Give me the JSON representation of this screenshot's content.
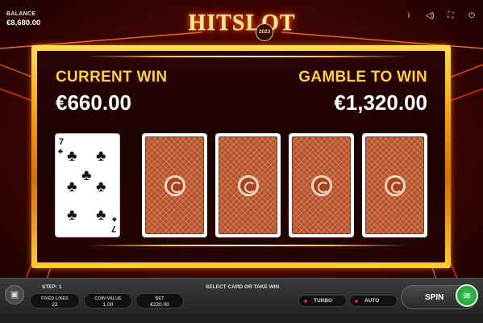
{
  "header": {
    "balance_label": "BALANCE",
    "balance_value": "€8,680.00",
    "logo_text": "HITSLOT",
    "logo_year": "2023",
    "icons": [
      "info-icon",
      "sound-icon",
      "fullscreen-icon",
      "power-icon"
    ],
    "icon_glyphs": {
      "info": "i",
      "sound": "◁)",
      "fullscreen": "⛶",
      "power": "⏻"
    }
  },
  "gamble": {
    "current_win_label": "CURRENT WIN",
    "current_win_value": "€660.00",
    "gamble_to_win_label": "GAMBLE TO WIN",
    "gamble_to_win_value": "€1,320.00",
    "dealer_card": {
      "rank": "7",
      "suit": "♣"
    },
    "face_down_cards": 4
  },
  "bottom_bar": {
    "step_label": "STEP: 1",
    "message": "SELECT CARD OR TAKE WIN",
    "fixed_lines_label": "FIXED LINES",
    "fixed_lines_value": "22",
    "coin_value_label": "COIN VALUE",
    "coin_value_value": "1.00",
    "bet_label": "BET",
    "bet_value": "€220.00",
    "turbo_label": "TURBO",
    "auto_label": "AUTO",
    "spin_label": "SPIN",
    "collect_icon": "≋",
    "paytable_icon": "▣"
  },
  "colors": {
    "accent_gold": "#ffcf3f",
    "frame_orange": "#f7a20a",
    "card_back": "#b6532c",
    "collect_green": "#3fd15b",
    "toggle_off": "#d8261d"
  }
}
